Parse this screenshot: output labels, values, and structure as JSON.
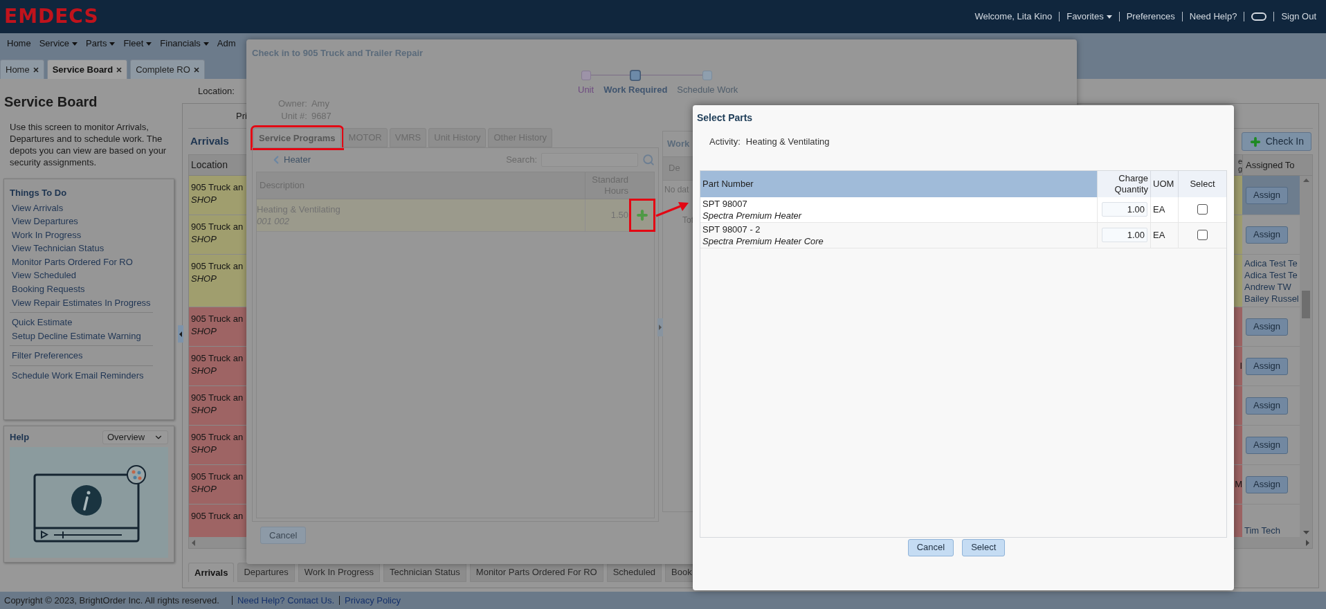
{
  "header": {
    "logo": "EMDECS",
    "links": [
      {
        "kind": "text",
        "label": "Welcome, Lita Kino"
      },
      {
        "kind": "menu",
        "label": "Favorites"
      },
      {
        "kind": "link",
        "label": "Preferences"
      },
      {
        "kind": "link",
        "label": "Need Help?"
      },
      {
        "kind": "icon"
      },
      {
        "kind": "link",
        "label": "Sign Out"
      }
    ]
  },
  "nav": [
    {
      "label": "Home",
      "menu": false
    },
    {
      "label": "Service",
      "menu": true
    },
    {
      "label": "Parts",
      "menu": true
    },
    {
      "label": "Fleet",
      "menu": true
    },
    {
      "label": "Financials",
      "menu": true
    },
    {
      "label": "Adm",
      "menu": false
    }
  ],
  "page_tabs": [
    {
      "label": "Home",
      "selected": false
    },
    {
      "label": "Service Board",
      "selected": true
    },
    {
      "label": "Complete RO",
      "selected": false
    }
  ],
  "sidebar": {
    "title": "Service Board",
    "intro": "Use this screen to monitor Arrivals, Departures and to schedule work. The depots you can view are based on your security assignments.",
    "todo": {
      "title": "Things To Do",
      "groups": [
        {
          "items": [
            "View Arrivals",
            "View Departures",
            "Work In Progress",
            "View Technician Status",
            "Monitor Parts Ordered For RO",
            "View Scheduled",
            "Booking Requests",
            "View Repair Estimates In Progress"
          ]
        },
        {
          "items": [
            "Quick Estimate",
            "Setup Decline Estimate Warning"
          ]
        },
        {
          "items": [
            "Filter Preferences"
          ]
        },
        {
          "items": [
            "Schedule Work Email Reminders"
          ]
        }
      ]
    },
    "help": {
      "title": "Help",
      "select": "Overview"
    }
  },
  "board": {
    "location_label": "Location:",
    "column_cut": "Pri",
    "title": "Arrivals",
    "check_in": "Check In",
    "columns": {
      "location": "Location",
      "column_2": [
        "e",
        "g"
      ],
      "assigned": "Assigned To"
    },
    "rows": [
      {
        "color": "#a09e6e",
        "location": "905 Truck an",
        "type": "SHOP",
        "selected": true,
        "assigned": {
          "kind": "button",
          "label": "Assign"
        }
      },
      {
        "color": "#a09e6e",
        "location": "905 Truck an",
        "type": "SHOP",
        "selected": false,
        "assigned": {
          "kind": "button",
          "label": "Assign"
        }
      },
      {
        "color": "#a09e6e",
        "location": "905 Truck an",
        "type": "SHOP",
        "selected": false,
        "assigned": {
          "kind": "names",
          "names": [
            "Adica Test Te",
            "Adica Test Te",
            "Andrew TW",
            "Bailey Russel"
          ]
        }
      },
      {
        "color": "#9e6464",
        "location": "905 Truck an",
        "type": "SHOP",
        "selected": false,
        "assigned": {
          "kind": "button",
          "label": "Assign"
        }
      },
      {
        "color": "#9e6464",
        "location": "905 Truck an",
        "type": "SHOP",
        "selected": false,
        "column_2": "I",
        "assigned": {
          "kind": "button",
          "label": "Assign"
        }
      },
      {
        "color": "#9e6464",
        "location": "905 Truck an",
        "type": "SHOP",
        "selected": false,
        "assigned": {
          "kind": "button",
          "label": "Assign"
        }
      },
      {
        "color": "#9e6464",
        "location": "905 Truck an",
        "type": "SHOP",
        "selected": false,
        "assigned": {
          "kind": "button",
          "label": "Assign"
        }
      },
      {
        "color": "#9e6464",
        "location": "905 Truck an",
        "type": "SHOP",
        "selected": false,
        "column_2": "M",
        "assigned": {
          "kind": "button",
          "label": "Assign"
        }
      },
      {
        "color": "#9e6464",
        "location": "905 Truck an",
        "selected": false,
        "assigned": {
          "kind": "names",
          "names": [
            "Tim Tech"
          ]
        }
      }
    ],
    "bottom_tabs": [
      {
        "label": "Arrivals",
        "selected": true
      },
      {
        "label": "Departures",
        "selected": false
      },
      {
        "label": "Work In Progress",
        "selected": false
      },
      {
        "label": "Technician Status",
        "selected": false
      },
      {
        "label": "Monitor Parts Ordered For RO",
        "selected": false
      },
      {
        "label": "Scheduled",
        "selected": false
      },
      {
        "label": "Book",
        "selected": false
      }
    ]
  },
  "check_in": {
    "title": "Check in to 905 Truck and Trailer Repair",
    "steps": [
      {
        "label": "Unit",
        "done": true,
        "selected": false
      },
      {
        "label": "Work Required",
        "done": false,
        "selected": true
      },
      {
        "label": "Schedule Work",
        "done": false,
        "selected": false
      }
    ],
    "info": [
      {
        "label": "Owner:",
        "value": "Amy"
      },
      {
        "label": "Unit #:",
        "value": "9687"
      }
    ],
    "tabs": [
      {
        "label": "Service Programs",
        "selected": true,
        "highlighted": true
      },
      {
        "label": "MOTOR",
        "selected": false,
        "highlighted": false
      },
      {
        "label": "VMRS",
        "selected": false,
        "highlighted": false
      },
      {
        "label": "Unit History",
        "selected": false,
        "highlighted": false
      },
      {
        "label": "Other History",
        "selected": false,
        "highlighted": false
      }
    ],
    "breadcrumb": "Heater",
    "search_label": "Search:",
    "columns": {
      "description": "Description",
      "hours": [
        "Standard",
        "Hours"
      ]
    },
    "rows": [
      {
        "description": "Heating & Ventilating",
        "code": "001 002",
        "hours": "1.50",
        "add_highlighted": true
      }
    ],
    "cancel": "Cancel",
    "work_panel": {
      "title": "Work",
      "column": "De",
      "empty": "No dat",
      "total": "Tot"
    }
  },
  "select_parts": {
    "title": "Select Parts",
    "activity_label": "Activity:",
    "activity": "Heating & Ventilating",
    "columns": {
      "part": "Part Number",
      "quantity": [
        "Charge",
        "Quantity"
      ],
      "uom": "UOM",
      "select": "Select"
    },
    "rows": [
      {
        "part": "SPT 98007",
        "name": "Spectra Premium Heater",
        "quantity": "1.00",
        "uom": "EA",
        "checked": false
      },
      {
        "part": "SPT 98007 - 2",
        "name": "Spectra Premium Heater Core",
        "quantity": "1.00",
        "uom": "EA",
        "checked": false
      }
    ],
    "buttons": [
      "Cancel",
      "Select"
    ]
  },
  "footer": {
    "copyright": "Copyright © 2023, BrightOrder Inc. All rights reserved.",
    "links": [
      "Need Help? Contact Us.",
      "Privacy Policy"
    ]
  }
}
